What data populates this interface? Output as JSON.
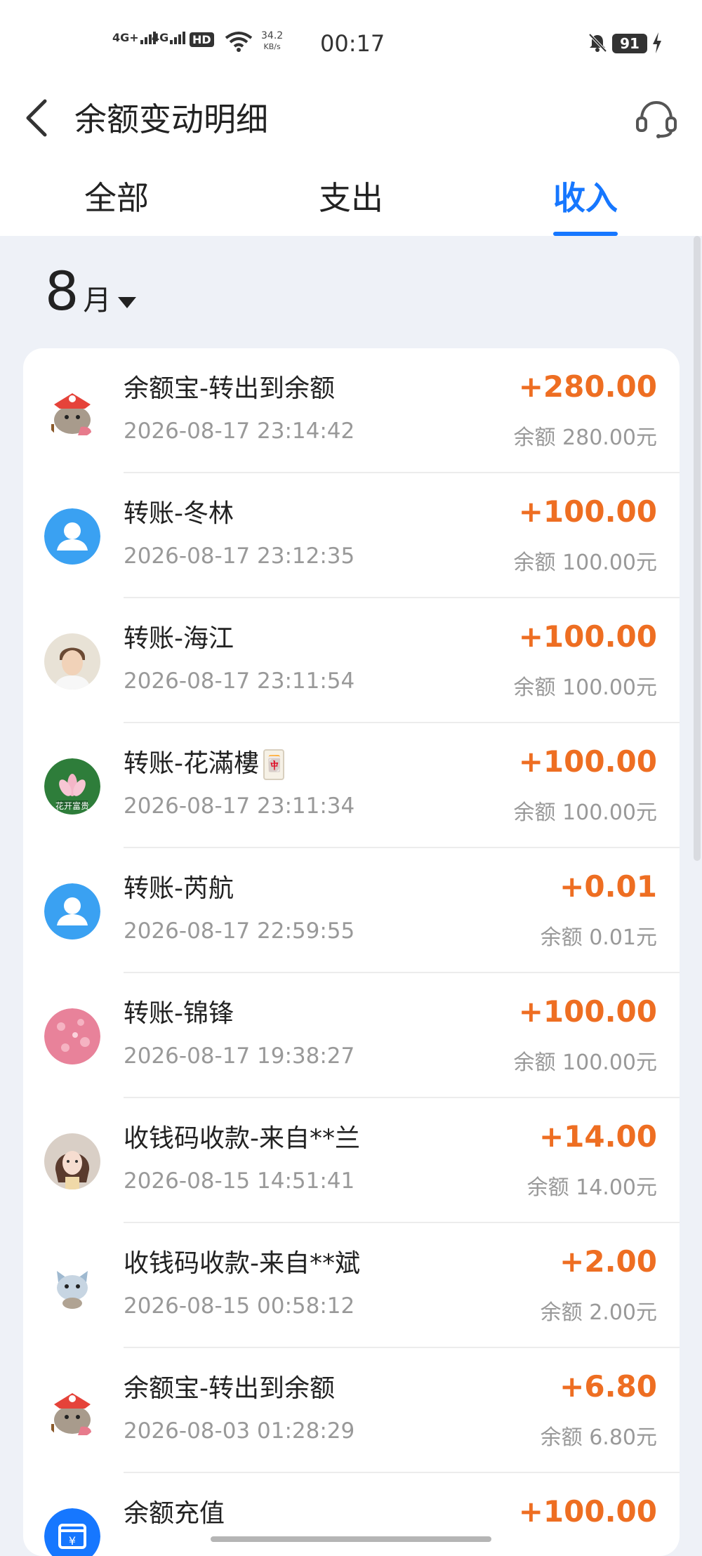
{
  "status_bar": {
    "net1": "4G+",
    "net2": "4G",
    "hd": "HD",
    "speed_value": "34.2",
    "speed_unit": "KB/s",
    "time": "00:17",
    "battery": "91"
  },
  "header": {
    "title": "余额变动明细"
  },
  "tabs": [
    {
      "label": "全部",
      "active": false
    },
    {
      "label": "支出",
      "active": false
    },
    {
      "label": "收入",
      "active": true
    }
  ],
  "month": {
    "number": "8",
    "unit": "月"
  },
  "transactions": [
    {
      "title": "余额宝-转出到余额",
      "time": "2026-08-17 23:14:42",
      "amount": "+280.00",
      "balance": "余额 280.00元",
      "avatar": "lion-dance-cat-avatar"
    },
    {
      "title": "转账-冬林",
      "time": "2026-08-17 23:12:35",
      "amount": "+100.00",
      "balance": "余额 100.00元",
      "avatar": "default-user-avatar"
    },
    {
      "title": "转账-海江",
      "time": "2026-08-17 23:11:54",
      "amount": "+100.00",
      "balance": "余额 100.00元",
      "avatar": "person-photo-avatar"
    },
    {
      "title": "转账-花滿樓",
      "time": "2026-08-17 23:11:34",
      "amount": "+100.00",
      "balance": "余额 100.00元",
      "avatar": "lotus-avatar",
      "avatar_caption": "花开富贵",
      "emoji": "🀄"
    },
    {
      "title": "转账-芮航",
      "time": "2026-08-17 22:59:55",
      "amount": "+0.01",
      "balance": "余额 0.01元",
      "avatar": "default-user-avatar"
    },
    {
      "title": "转账-锦锋",
      "time": "2026-08-17 19:38:27",
      "amount": "+100.00",
      "balance": "余额 100.00元",
      "avatar": "pink-texture-avatar"
    },
    {
      "title": "收钱码收款-来自**兰",
      "time": "2026-08-15 14:51:41",
      "amount": "+14.00",
      "balance": "余额 14.00元",
      "avatar": "girl-photo-avatar"
    },
    {
      "title": "收钱码收款-来自**斌",
      "time": "2026-08-15 00:58:12",
      "amount": "+2.00",
      "balance": "余额 2.00元",
      "avatar": "cat-sticker-avatar"
    },
    {
      "title": "余额宝-转出到余额",
      "time": "2026-08-03 01:28:29",
      "amount": "+6.80",
      "balance": "余额 6.80元",
      "avatar": "lion-dance-cat-avatar"
    },
    {
      "title": "余额充值",
      "time": "",
      "amount": "+100.00",
      "balance": "",
      "avatar": "recharge-icon-avatar"
    }
  ],
  "colors": {
    "accent": "#1677ff",
    "amount": "#ee6e22"
  }
}
